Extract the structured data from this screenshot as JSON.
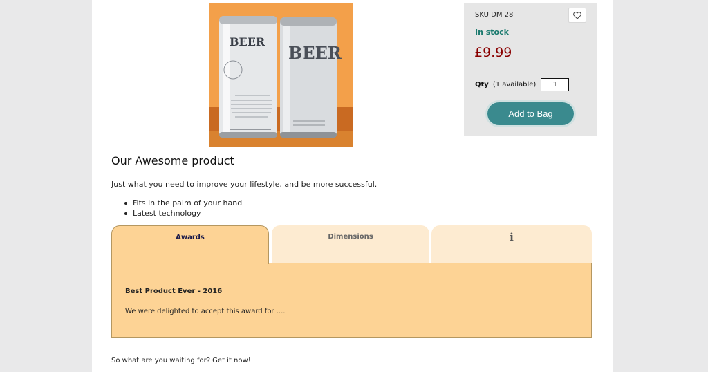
{
  "product": {
    "image_alt": "BEER",
    "can1_label": "BEER",
    "can2_label": "BEER"
  },
  "purchase": {
    "sku": "SKU DM 28",
    "stock": "In stock",
    "price": "£9.99",
    "qty_label": "Qty",
    "qty_available": "(1 available)",
    "qty_value": "1",
    "add_button": "Add to Bag",
    "wishlist_icon": "heart-icon"
  },
  "description": {
    "title": "Our Awesome product",
    "text": "Just what you need to improve your lifestyle, and be more successful.",
    "bullets": [
      "Fits in the palm of your hand",
      "Latest technology"
    ]
  },
  "tabs": [
    {
      "label": "Awards",
      "active": true
    },
    {
      "label": "Dimensions",
      "active": false
    },
    {
      "label": "i",
      "active": false
    }
  ],
  "award": {
    "title": "Best Product Ever - 2016",
    "text": "We were delighted to accept this award for ...."
  },
  "cta": "So what are you waiting for? Get it now!",
  "colors": {
    "stock": "#1b7a6e",
    "price": "#8a0000",
    "button": "#3a8a8e",
    "tab_active": "#fdd395",
    "tab_inactive": "#fdebd1"
  }
}
